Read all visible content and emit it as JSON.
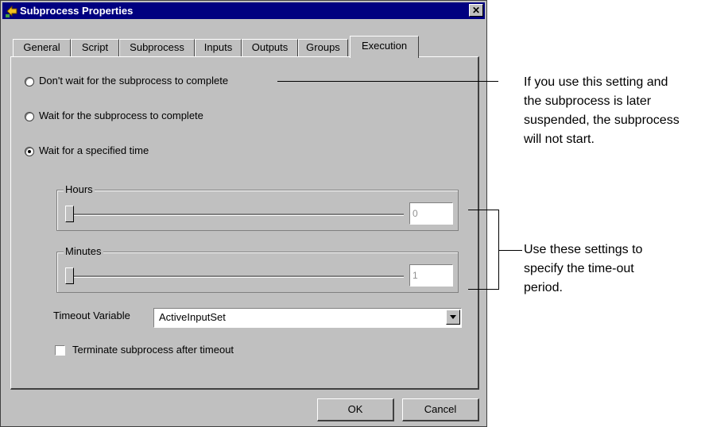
{
  "window": {
    "title": "Subprocess Properties",
    "close_glyph": "✕"
  },
  "tabs": [
    {
      "label": "General"
    },
    {
      "label": "Script"
    },
    {
      "label": "Subprocess"
    },
    {
      "label": "Inputs"
    },
    {
      "label": "Outputs"
    },
    {
      "label": "Groups"
    },
    {
      "label": "Execution",
      "active": true
    }
  ],
  "options": {
    "no_wait": "Don't wait for the subprocess to complete",
    "wait": "Wait for the subprocess to complete",
    "wait_time": "Wait for a specified time",
    "selected": "wait_time"
  },
  "hours": {
    "label": "Hours",
    "value": "0",
    "slider_fraction": 0
  },
  "minutes": {
    "label": "Minutes",
    "value": "1",
    "slider_fraction": 0
  },
  "timeout_variable": {
    "label": "Timeout Variable",
    "value": "ActiveInputSet"
  },
  "terminate": {
    "label": "Terminate subprocess after timeout",
    "checked": false
  },
  "buttons": {
    "ok": "OK",
    "cancel": "Cancel"
  },
  "annotations": {
    "first": [
      "If you use this setting and",
      "the subprocess is later",
      "suspended, the subprocess",
      "will not start."
    ],
    "second": [
      "Use these settings to",
      "specify the time-out",
      "period."
    ]
  },
  "colors": {
    "titlebar": "#000080",
    "face": "#c0c0c0"
  }
}
